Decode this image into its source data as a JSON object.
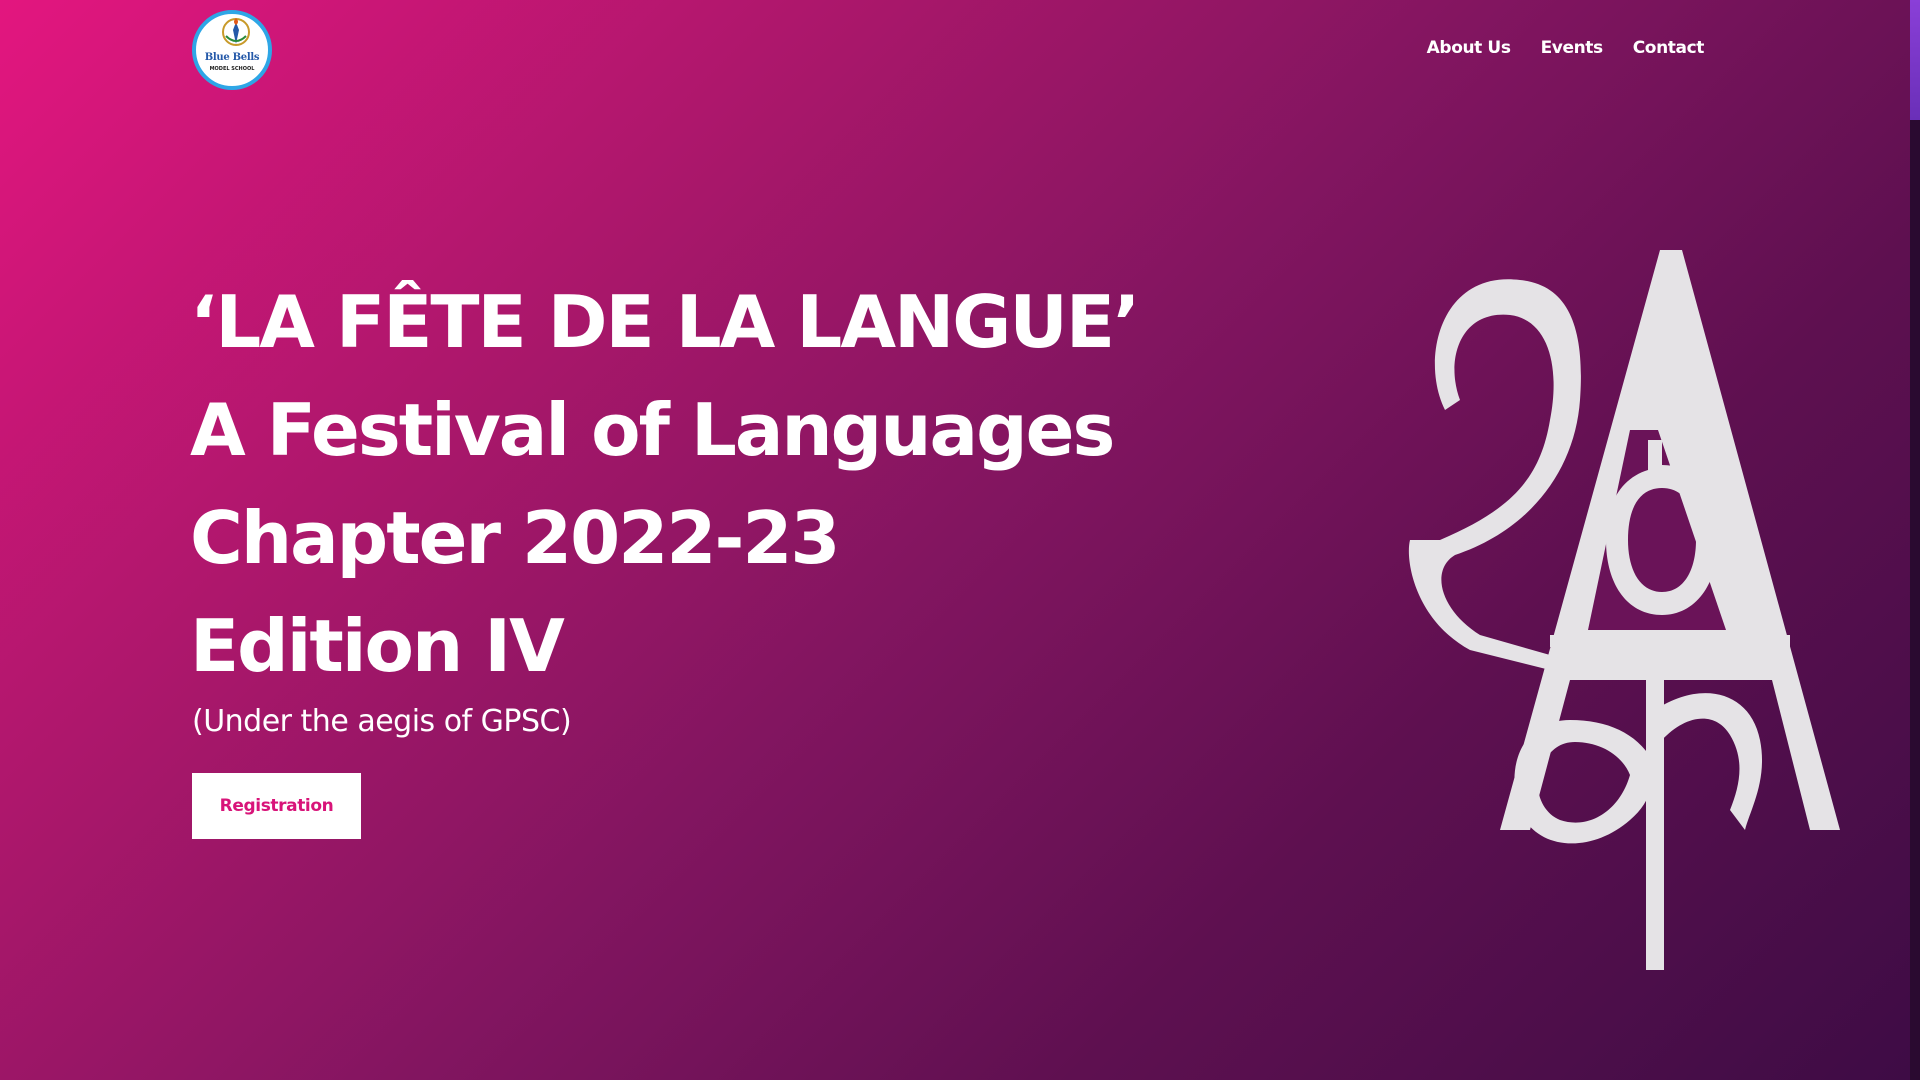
{
  "logo": {
    "name_line1": "Blue Bells",
    "name_line2": "MODEL SCHOOL"
  },
  "nav": {
    "items": [
      "About Us",
      "Events",
      "Contact"
    ]
  },
  "hero": {
    "lines": [
      "‘LA FÊTE DE LA LANGUE’",
      "A Festival of Languages",
      "Chapter 2022-23",
      "Edition IV"
    ],
    "subtitle": "(Under the aegis of GPSC)",
    "button_label": "Registration",
    "emblem_icon": "language-festival-emblem-icon"
  },
  "colors": {
    "gradient_start": "#e3167f",
    "gradient_end": "#3e0c45",
    "button_text": "#d81479",
    "emblem": "#e5e3e6",
    "scroll_thumb": "#7a37c8"
  }
}
